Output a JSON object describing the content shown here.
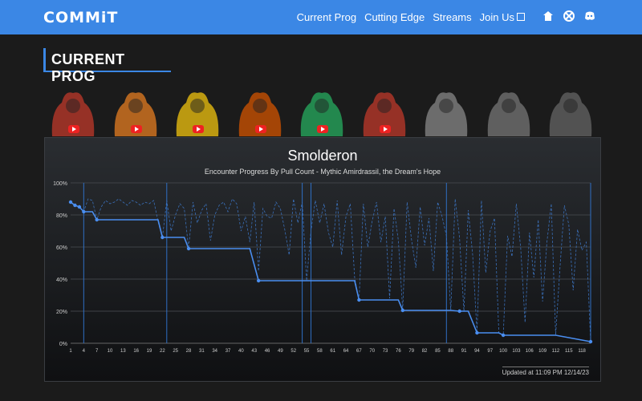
{
  "header": {
    "logo": "COMMiT",
    "nav": [
      {
        "label": "Current Prog"
      },
      {
        "label": "Cutting Edge"
      },
      {
        "label": "Streams"
      },
      {
        "label": "Join Us"
      }
    ],
    "icons": [
      "guild-icon",
      "raider-icon",
      "discord-icon"
    ]
  },
  "section": {
    "title": "CURRENT PROG"
  },
  "bosses": [
    {
      "name": "gnarlroot",
      "color": "#c0392b"
    },
    {
      "name": "igira",
      "color": "#e67e22"
    },
    {
      "name": "volcoross",
      "color": "#f1c40f"
    },
    {
      "name": "council",
      "color": "#d35400"
    },
    {
      "name": "larodar",
      "color": "#27ae60"
    },
    {
      "name": "nymue",
      "color": "#c0392b"
    },
    {
      "name": "smolderon",
      "color": "#888888"
    },
    {
      "name": "tindral",
      "color": "#777777"
    },
    {
      "name": "fyrakk",
      "color": "#666666"
    }
  ],
  "chart_data": {
    "type": "line",
    "title": "Smolderon",
    "subtitle": "Encounter Progress By Pull Count - Mythic Amirdrassil, the Dream's Hope",
    "xlabel": "",
    "ylabel": "",
    "ylim": [
      0,
      100
    ],
    "yticks": [
      "0%",
      "20%",
      "40%",
      "60%",
      "80%",
      "100%"
    ],
    "xticks": [
      1,
      4,
      7,
      10,
      13,
      16,
      19,
      22,
      25,
      28,
      31,
      34,
      37,
      40,
      43,
      46,
      49,
      52,
      55,
      58,
      61,
      64,
      67,
      70,
      73,
      76,
      79,
      82,
      85,
      88,
      91,
      94,
      97,
      100,
      103,
      106,
      109,
      112,
      115,
      118
    ],
    "session_markers": [
      4,
      23,
      54,
      56,
      87,
      120
    ],
    "best_progress": {
      "x": [
        1,
        2,
        3,
        4,
        6,
        7,
        21,
        22,
        27,
        28,
        42,
        44,
        66,
        67,
        76,
        77,
        88,
        90,
        92,
        94,
        99,
        100,
        111,
        112,
        120
      ],
      "y": [
        88,
        86,
        85,
        82,
        82,
        77,
        77,
        66,
        66,
        59,
        59,
        39,
        39,
        27,
        27,
        20.5,
        20.5,
        20,
        20,
        6.5,
        6.5,
        5,
        5,
        5,
        1
      ]
    },
    "pull_progress": {
      "x": [
        1,
        2,
        3,
        4,
        5,
        6,
        7,
        8,
        9,
        10,
        11,
        12,
        13,
        14,
        15,
        16,
        17,
        18,
        19,
        20,
        21,
        22,
        23,
        24,
        25,
        26,
        27,
        28,
        29,
        30,
        31,
        32,
        33,
        34,
        35,
        36,
        37,
        38,
        39,
        40,
        41,
        42,
        43,
        44,
        45,
        46,
        47,
        48,
        49,
        50,
        51,
        52,
        53,
        54,
        55,
        56,
        57,
        58,
        59,
        60,
        61,
        62,
        63,
        64,
        65,
        66,
        67,
        68,
        69,
        70,
        71,
        72,
        73,
        74,
        75,
        76,
        77,
        78,
        79,
        80,
        81,
        82,
        83,
        84,
        85,
        86,
        87,
        88,
        89,
        90,
        91,
        92,
        93,
        94,
        95,
        96,
        97,
        98,
        99,
        100,
        101,
        102,
        103,
        104,
        105,
        106,
        107,
        108,
        109,
        110,
        111,
        112,
        113,
        114,
        115,
        116,
        117,
        118,
        119,
        120
      ],
      "y": [
        88,
        86,
        85,
        82,
        90,
        89,
        77,
        85,
        89,
        87,
        88,
        90,
        88,
        86,
        89,
        88,
        86,
        88,
        87,
        89,
        76,
        66,
        89,
        70,
        80,
        87,
        84,
        59,
        88,
        75,
        83,
        87,
        64,
        80,
        86,
        88,
        82,
        90,
        87,
        70,
        79,
        63,
        88,
        45,
        84,
        79,
        78,
        88,
        84,
        71,
        55,
        90,
        75,
        88,
        39,
        70,
        89,
        75,
        87,
        69,
        60,
        89,
        55,
        79,
        87,
        41,
        27,
        87,
        60,
        76,
        88,
        63,
        79,
        28,
        84,
        64,
        21,
        88,
        65,
        47,
        85,
        61,
        78,
        45,
        88,
        79,
        67,
        20.5,
        90,
        66,
        20,
        83,
        55,
        6.5,
        89,
        44,
        70,
        78,
        6.5,
        5,
        67,
        54,
        87,
        59,
        13,
        69,
        41,
        77,
        26,
        63,
        87,
        5,
        48,
        86,
        74,
        33,
        71,
        58,
        63,
        1
      ]
    },
    "updated": "Updated at 11:09 PM 12/14/23"
  }
}
